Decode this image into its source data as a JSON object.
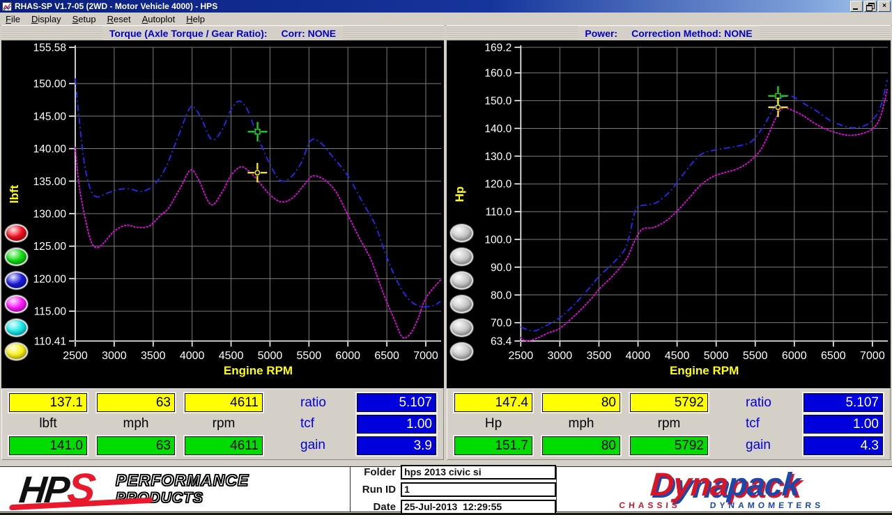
{
  "window": {
    "title": "RHAS-SP V1.7-05   (2WD - Motor Vehicle 4000) - HPS",
    "controls": [
      {
        "name": "minimize-button"
      },
      {
        "name": "restore-button"
      },
      {
        "name": "close-button"
      }
    ]
  },
  "menu": {
    "items": [
      {
        "label": "File"
      },
      {
        "label": "Display"
      },
      {
        "label": "Setup"
      },
      {
        "label": "Reset"
      },
      {
        "label": "Autoplot"
      },
      {
        "label": "Help"
      }
    ]
  },
  "chart_data": [
    {
      "type": "line",
      "header": {
        "title": "Torque (Axle Torque / Gear Ratio):",
        "corr": "Corr: NONE"
      },
      "x_axis": {
        "label": "Engine RPM",
        "min": 2500,
        "max": 7000,
        "values": [
          2500,
          3000,
          3500,
          4000,
          4500,
          5000,
          5500,
          6000,
          6500,
          7000
        ],
        "labels": [
          "2500",
          "3000",
          "3500",
          "4000",
          "4500",
          "5000",
          "5500",
          "6000",
          "6500",
          "7000"
        ]
      },
      "y_axis": {
        "label": "lbft",
        "min": 110.41,
        "max": 155.58,
        "values": [
          155.58,
          150,
          145,
          140,
          135,
          130,
          125,
          120,
          115,
          110.41
        ],
        "labels": [
          "155.58",
          "150.00",
          "145.00",
          "140.00",
          "135.00",
          "130.00",
          "125.00",
          "120.00",
          "115.00",
          "110.41"
        ]
      },
      "grid_color": "#7c7c7c",
      "series": [
        {
          "name": "torque-run-blue",
          "color": "#2828f8",
          "style": "dashdot",
          "points": [
            [
              2500,
              150.8
            ],
            [
              2550,
              144.5
            ],
            [
              2620,
              137.5
            ],
            [
              2700,
              133.6
            ],
            [
              2780,
              132.6
            ],
            [
              2900,
              133.1
            ],
            [
              3050,
              133.7
            ],
            [
              3200,
              133.8
            ],
            [
              3350,
              133.4
            ],
            [
              3500,
              134.3
            ],
            [
              3650,
              136.8
            ],
            [
              3800,
              141.2
            ],
            [
              3950,
              145.8
            ],
            [
              4020,
              146.4
            ],
            [
              4120,
              144.6
            ],
            [
              4250,
              141.4
            ],
            [
              4380,
              142.8
            ],
            [
              4500,
              146.0
            ],
            [
              4600,
              147.3
            ],
            [
              4700,
              146.2
            ],
            [
              4800,
              143.2
            ],
            [
              4900,
              140.2
            ],
            [
              5000,
              137.6
            ],
            [
              5120,
              135.2
            ],
            [
              5250,
              135.4
            ],
            [
              5400,
              137.8
            ],
            [
              5520,
              141.2
            ],
            [
              5650,
              140.9
            ],
            [
              5800,
              138.8
            ],
            [
              6000,
              135.8
            ],
            [
              6200,
              131.5
            ],
            [
              6350,
              128.3
            ],
            [
              6500,
              123.3
            ],
            [
              6650,
              119.2
            ],
            [
              6800,
              116.6
            ],
            [
              6950,
              115.7
            ],
            [
              7100,
              115.9
            ],
            [
              7190,
              116.5
            ]
          ]
        },
        {
          "name": "torque-run-magenta",
          "color": "#f400f4",
          "style": "dotted",
          "points": [
            [
              2500,
              140.2
            ],
            [
              2560,
              133.5
            ],
            [
              2680,
              126.6
            ],
            [
              2760,
              124.8
            ],
            [
              2850,
              125.3
            ],
            [
              3000,
              127.3
            ],
            [
              3150,
              128.2
            ],
            [
              3300,
              127.9
            ],
            [
              3450,
              128.1
            ],
            [
              3600,
              129.8
            ],
            [
              3700,
              130.9
            ],
            [
              3850,
              134.0
            ],
            [
              3980,
              136.7
            ],
            [
              4080,
              135.3
            ],
            [
              4240,
              131.4
            ],
            [
              4380,
              133.2
            ],
            [
              4500,
              135.9
            ],
            [
              4630,
              137.2
            ],
            [
              4750,
              136.3
            ],
            [
              4850,
              135.0
            ],
            [
              5000,
              132.9
            ],
            [
              5150,
              131.8
            ],
            [
              5300,
              132.5
            ],
            [
              5450,
              134.6
            ],
            [
              5550,
              135.8
            ],
            [
              5700,
              135.2
            ],
            [
              5850,
              133.3
            ],
            [
              6000,
              129.8
            ],
            [
              6150,
              126.2
            ],
            [
              6300,
              122.8
            ],
            [
              6450,
              117.9
            ],
            [
              6600,
              113.6
            ],
            [
              6700,
              111.0
            ],
            [
              6800,
              111.5
            ],
            [
              6900,
              113.8
            ],
            [
              7000,
              117.0
            ],
            [
              7190,
              119.8
            ]
          ]
        }
      ],
      "markers": [
        {
          "name": "cursor-green",
          "shape": "square",
          "color": "#22cc22",
          "rpm": 4840,
          "value": 142.6
        },
        {
          "name": "cursor-yellow",
          "shape": "circle",
          "color": "#f2e428",
          "rpm": 4838,
          "value": 136.3
        }
      ],
      "buttons": [
        {
          "name": "red",
          "color": "#ee1020"
        },
        {
          "name": "green",
          "color": "#10dc10"
        },
        {
          "name": "blue",
          "color": "#1818d8"
        },
        {
          "name": "magenta",
          "color": "#f818f8"
        },
        {
          "name": "cyan",
          "color": "#18e8e8"
        },
        {
          "name": "yellow",
          "color": "#f8ef18"
        }
      ]
    },
    {
      "type": "line",
      "header": {
        "title": "Power:",
        "corr": "Correction Method: NONE"
      },
      "x_axis": {
        "label": "Engine RPM",
        "min": 2500,
        "max": 7000,
        "values": [
          2500,
          3000,
          3500,
          4000,
          4500,
          5000,
          5500,
          6000,
          6500,
          7000
        ],
        "labels": [
          "2500",
          "3000",
          "3500",
          "4000",
          "4500",
          "5000",
          "5500",
          "6000",
          "6500",
          "7000"
        ]
      },
      "y_axis": {
        "label": "Hp",
        "min": 63.4,
        "max": 169.2,
        "values": [
          169.2,
          160,
          150,
          140,
          130,
          120,
          110,
          100,
          90,
          80,
          70,
          63.4
        ],
        "labels": [
          "169.2",
          "160.0",
          "150.0",
          "140.0",
          "130.0",
          "120.0",
          "110.0",
          "100.0",
          "90.0",
          "80.0",
          "70.0",
          "63.4"
        ]
      },
      "grid_color": "#7c7c7c",
      "series": [
        {
          "name": "power-run-blue",
          "color": "#2828f8",
          "style": "dashdot",
          "points": [
            [
              2500,
              68.4
            ],
            [
              2660,
              67.0
            ],
            [
              2800,
              68.6
            ],
            [
              3000,
              71.8
            ],
            [
              3200,
              77.0
            ],
            [
              3400,
              83.2
            ],
            [
              3500,
              86.6
            ],
            [
              3700,
              92.0
            ],
            [
              3850,
              97.5
            ],
            [
              3950,
              109.0
            ],
            [
              4000,
              111.8
            ],
            [
              4150,
              112.6
            ],
            [
              4250,
              113.5
            ],
            [
              4400,
              117.0
            ],
            [
              4500,
              120.5
            ],
            [
              4650,
              126.0
            ],
            [
              4800,
              130.5
            ],
            [
              4950,
              132.0
            ],
            [
              5150,
              133.0
            ],
            [
              5300,
              133.8
            ],
            [
              5450,
              135.2
            ],
            [
              5600,
              140.5
            ],
            [
              5700,
              145.5
            ],
            [
              5800,
              150.2
            ],
            [
              5900,
              151.8
            ],
            [
              6000,
              151.2
            ],
            [
              6150,
              148.5
            ],
            [
              6300,
              146.0
            ],
            [
              6450,
              143.0
            ],
            [
              6600,
              141.2
            ],
            [
              6750,
              140.2
            ],
            [
              6900,
              141.0
            ],
            [
              7000,
              143.0
            ],
            [
              7100,
              147.5
            ],
            [
              7190,
              157.5
            ]
          ]
        },
        {
          "name": "power-run-magenta",
          "color": "#f400f4",
          "style": "dotted",
          "points": [
            [
              2500,
              64.6
            ],
            [
              2570,
              63.4
            ],
            [
              2700,
              64.3
            ],
            [
              2850,
              66.3
            ],
            [
              3000,
              68.0
            ],
            [
              3200,
              72.8
            ],
            [
              3400,
              78.6
            ],
            [
              3500,
              82.0
            ],
            [
              3700,
              87.6
            ],
            [
              3850,
              92.8
            ],
            [
              3950,
              99.0
            ],
            [
              4050,
              103.6
            ],
            [
              4200,
              104.3
            ],
            [
              4350,
              106.5
            ],
            [
              4500,
              110.2
            ],
            [
              4650,
              114.8
            ],
            [
              4800,
              119.5
            ],
            [
              4950,
              122.5
            ],
            [
              5100,
              124.0
            ],
            [
              5250,
              125.2
            ],
            [
              5400,
              127.5
            ],
            [
              5550,
              131.5
            ],
            [
              5650,
              136.5
            ],
            [
              5750,
              143.0
            ],
            [
              5850,
              147.3
            ],
            [
              5950,
              146.8
            ],
            [
              6100,
              144.8
            ],
            [
              6250,
              142.0
            ],
            [
              6400,
              139.8
            ],
            [
              6550,
              138.3
            ],
            [
              6700,
              137.5
            ],
            [
              6850,
              138.0
            ],
            [
              7000,
              139.8
            ],
            [
              7100,
              144.0
            ],
            [
              7190,
              154.0
            ]
          ]
        }
      ],
      "markers": [
        {
          "name": "cursor-green",
          "shape": "square",
          "color": "#22cc22",
          "rpm": 5792,
          "value": 151.7
        },
        {
          "name": "cursor-yellow",
          "shape": "circle",
          "color": "#f2e428",
          "rpm": 5792,
          "value": 147.6
        }
      ],
      "buttons": [
        {
          "name": "gray-1",
          "color": "#c8c8c8"
        },
        {
          "name": "gray-2",
          "color": "#c8c8c8"
        },
        {
          "name": "gray-3",
          "color": "#c8c8c8"
        },
        {
          "name": "gray-4",
          "color": "#c8c8c8"
        },
        {
          "name": "gray-5",
          "color": "#c8c8c8"
        },
        {
          "name": "gray-6",
          "color": "#c8c8c8"
        }
      ]
    }
  ],
  "readouts": [
    {
      "values_top": [
        "137.1",
        "63",
        "4611"
      ],
      "units": [
        "lbft",
        "mph",
        "rpm"
      ],
      "values_bottom": [
        "141.0",
        "63",
        "4611"
      ],
      "side_labels": [
        "ratio",
        "tcf",
        "gain"
      ],
      "side_values": [
        "5.107",
        "1.00",
        "3.9"
      ]
    },
    {
      "values_top": [
        "147.4",
        "80",
        "5792"
      ],
      "units": [
        "Hp",
        "mph",
        "rpm"
      ],
      "values_bottom": [
        "151.7",
        "80",
        "5792"
      ],
      "side_labels": [
        "ratio",
        "tcf",
        "gain"
      ],
      "side_values": [
        "5.107",
        "1.00",
        "4.3"
      ]
    }
  ],
  "footer": {
    "hps": {
      "hp": "HP",
      "s": "S",
      "line1": "PERFORMANCE",
      "line2": "PRODUCTS"
    },
    "fields": [
      {
        "label": "Folder",
        "value": "hps 2013 civic si"
      },
      {
        "label": "Run ID",
        "value": "1"
      },
      {
        "label": "Date",
        "value": "25-Jul-2013  12:29:55"
      }
    ],
    "dynapack": {
      "word1": "Dyna",
      "word2": "pack",
      "sub1": "CHASSIS",
      "sub2": "DYNAMOMETERS"
    }
  }
}
